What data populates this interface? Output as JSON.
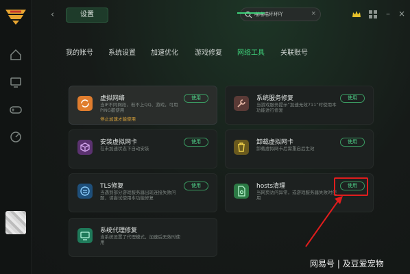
{
  "app": {
    "title_tab": "设置",
    "search_value": "喵喵喵坏坏吖",
    "search_clear": "×"
  },
  "tabs": [
    {
      "label": "我的账号",
      "active": false
    },
    {
      "label": "系统设置",
      "active": false
    },
    {
      "label": "加速优化",
      "active": false
    },
    {
      "label": "游戏修复",
      "active": false
    },
    {
      "label": "网络工具",
      "active": true
    },
    {
      "label": "关联账号",
      "active": false
    }
  ],
  "cards": [
    {
      "title": "虚拟网络",
      "desc": "当IP不同网段，若不上QQ、游戏，可用PING都使用",
      "note": "停止加速才能使用",
      "button": "使用",
      "icon": "refresh-icon",
      "color": "#e07d2e"
    },
    {
      "title": "系统服务修复",
      "desc": "当游戏服务提示“加速无效711”时使用本功能进行修复",
      "note": "",
      "button": "使用",
      "icon": "wrench-icon",
      "color": "#5a3a36"
    },
    {
      "title": "安装虚拟网卡",
      "desc": "在未加速状态下自动安装",
      "note": "",
      "button": "使用",
      "icon": "cube-icon",
      "color": "#5b3270"
    },
    {
      "title": "卸载虚拟网卡",
      "desc": "卸载虚拟网卡后需重启后生效",
      "note": "",
      "button": "使用",
      "icon": "trash-icon",
      "color": "#6a5a1e"
    },
    {
      "title": "TLS修复",
      "desc": "当遇到部分游戏服务器出现连接失败问题，请尝试使用本功能修复",
      "note": "",
      "button": "使用",
      "icon": "shield-icon",
      "color": "#1e4f7a"
    },
    {
      "title": "hosts清理",
      "desc": "当网页访问异常，或游戏服务器失败时使用",
      "note": "",
      "button": "使用",
      "icon": "file-icon",
      "color": "#2c7a45"
    },
    {
      "title": "系统代理修复",
      "desc": "当系统设置了代理模式，加速后无效时使用",
      "note": "",
      "button": "",
      "icon": "monitor-icon",
      "color": "#1f7a5a"
    }
  ],
  "watermark": "网易号 | 及豆爱宠物",
  "colors": {
    "accent": "#3fd07a",
    "highlight": "#e01d1d"
  }
}
